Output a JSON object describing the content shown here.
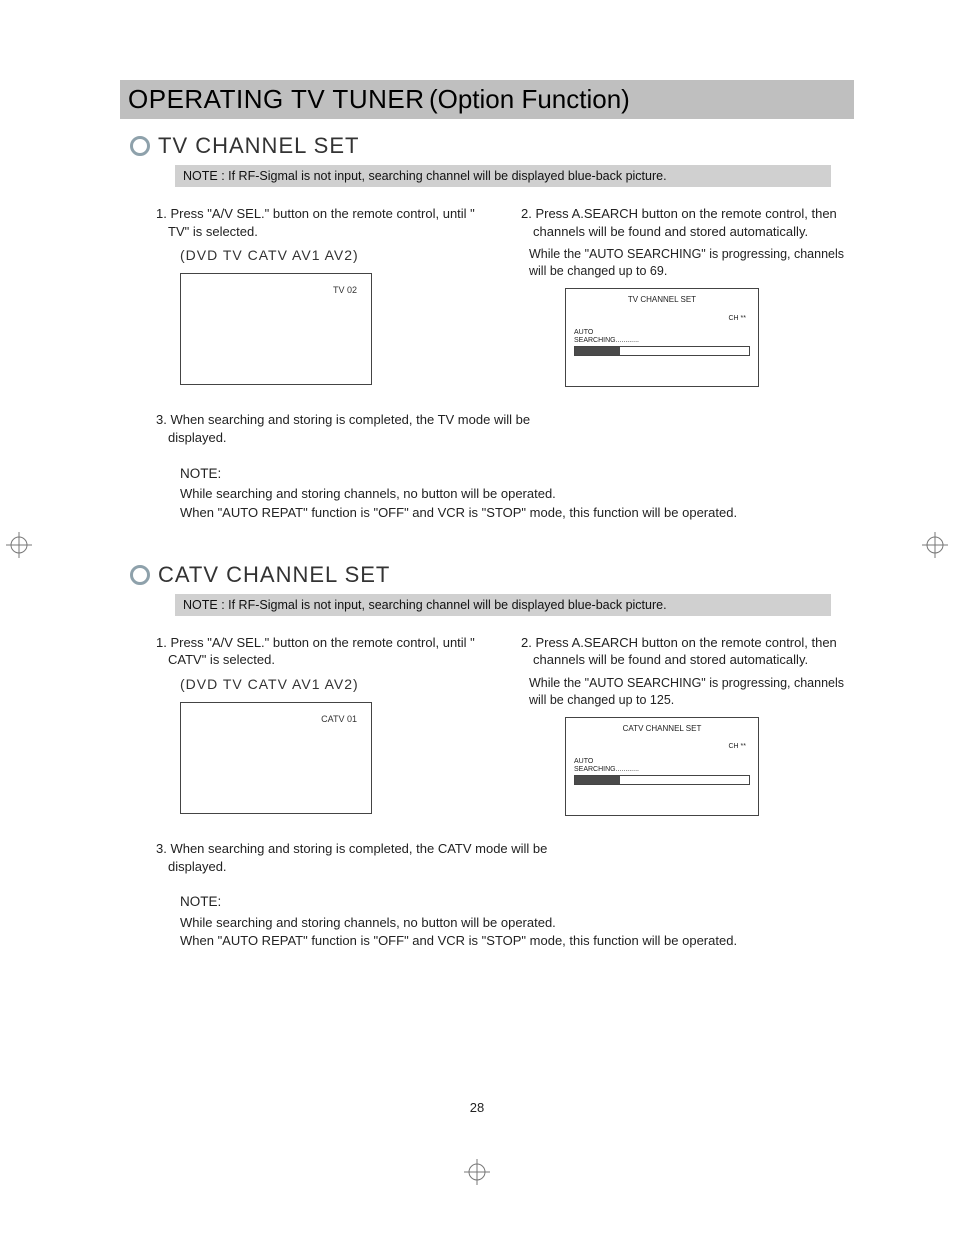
{
  "title": {
    "part1": "OPERATING TV TUNER",
    "part2": "(Option Function)"
  },
  "page_number": "28",
  "sections": [
    {
      "heading": "TV CHANNEL SET",
      "note_bar": "NOTE : If RF-Sigmal is not input, searching channel will be displayed blue-back picture.",
      "left": {
        "step1": "1. Press \"A/V SEL.\" button on the remote control, until \" TV\" is selected.",
        "inputs_line": "(DVD    TV    CATV    AV1    AV2)",
        "box_label": "TV 02"
      },
      "right": {
        "step2": "2. Press A.SEARCH button on the remote control, then channels will be found and stored automatically.",
        "sub": "While the \"AUTO SEARCHING\" is progressing, channels will be changed up to 69.",
        "screen": {
          "title": "TV CHANNEL SET",
          "ch": "CH **",
          "auto": "AUTO\nSEARCHING............"
        }
      },
      "step3": "3. When searching and storing is completed, the TV mode will be displayed.",
      "note_block": {
        "head": "NOTE:",
        "l1": "While searching and storing channels, no button will be operated.",
        "l2": "When \"AUTO REPAT\" function is \"OFF\" and VCR is \"STOP\" mode, this function will be operated."
      }
    },
    {
      "heading": "CATV CHANNEL SET",
      "note_bar": "NOTE : If RF-Sigmal is not input, searching channel will be displayed blue-back picture.",
      "left": {
        "step1": "1. Press \"A/V SEL.\" button on the remote control, until \" CATV\" is selected.",
        "inputs_line": "(DVD    TV    CATV    AV1    AV2)",
        "box_label": "CATV 01"
      },
      "right": {
        "step2": "2. Press A.SEARCH button on the remote control, then channels will be found and stored automatically.",
        "sub": "While the \"AUTO SEARCHING\" is progressing, channels will be changed up to 125.",
        "screen": {
          "title": "CATV CHANNEL SET",
          "ch": "CH **",
          "auto": "AUTO\nSEARCHING............"
        }
      },
      "step3": "3. When searching and storing is completed, the CATV mode will be displayed.",
      "note_block": {
        "head": "NOTE:",
        "l1": "While searching and storing channels, no button will be operated.",
        "l2": "When \"AUTO REPAT\" function is \"OFF\" and VCR is \"STOP\" mode, this function will be operated."
      }
    }
  ]
}
